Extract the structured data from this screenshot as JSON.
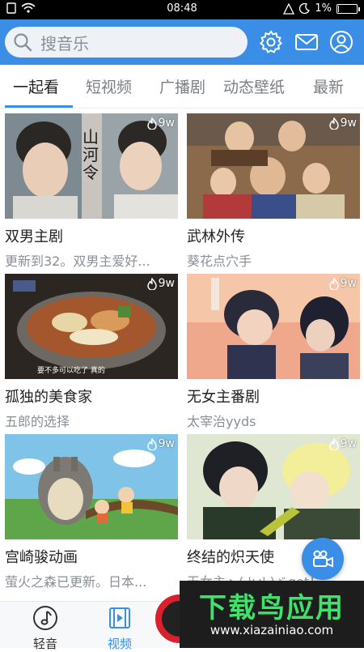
{
  "status_bar": {
    "time": "08:48",
    "battery": "1%",
    "battery_level": 0.01
  },
  "search": {
    "placeholder": "搜音乐"
  },
  "tabs": [
    {
      "label": "一起看",
      "active": true
    },
    {
      "label": "短视频",
      "active": false
    },
    {
      "label": "广播剧",
      "active": false
    },
    {
      "label": "动态壁纸",
      "active": false
    },
    {
      "label": "最新",
      "active": false
    }
  ],
  "cards": [
    {
      "title": "双男主剧",
      "subtitle": "更新到32。双男主爱好...",
      "views": "9w",
      "thumb_text": "山河令"
    },
    {
      "title": "武林外传",
      "subtitle": "葵花点穴手",
      "views": "9w"
    },
    {
      "title": "孤独的美食家",
      "subtitle": "五郎的选择",
      "views": "9w",
      "thumb_text": "要不多可以吃了 真的"
    },
    {
      "title": "无女主番剧",
      "subtitle": "太宰治yyds",
      "views": "9w"
    },
    {
      "title": "宫崎骏动画",
      "subtitle": "萤火之森已更新。日本...",
      "views": "9w"
    },
    {
      "title": "终结的炽天使",
      "subtitle": "无女主ヽ( 'ω' )ゞget！",
      "views": "9w"
    }
  ],
  "bottom_nav": [
    {
      "label": "轻音",
      "icon": "music-note-icon",
      "active": false
    },
    {
      "label": "视频",
      "icon": "film-icon",
      "active": true
    }
  ],
  "watermark": {
    "brand": "下载鸟应用",
    "url": "www.xiazainiao.com"
  },
  "colors": {
    "accent": "#3b8ee6",
    "watermark_green": "#3fe36b"
  }
}
